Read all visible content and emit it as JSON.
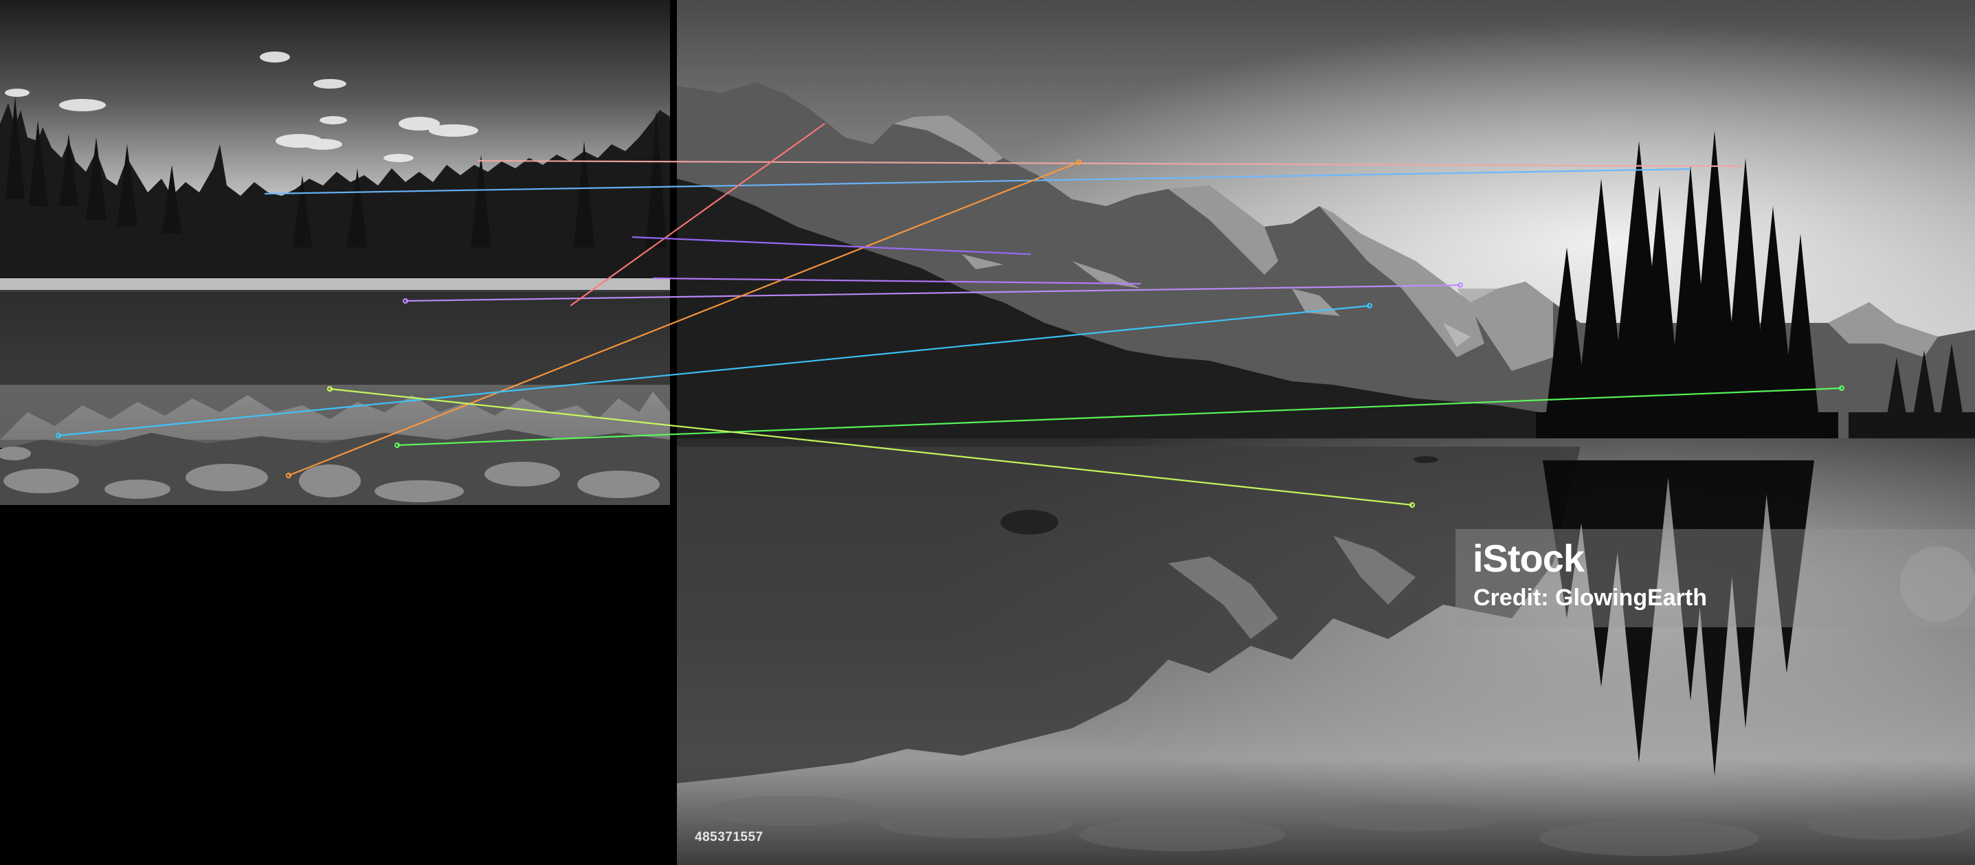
{
  "watermark": {
    "logo": "iStock",
    "credit": "Credit: GlowingEarth"
  },
  "image_id": "485371557",
  "match_colors": [
    "#f4a6a0",
    "#6ab7ff",
    "#c08cff",
    "#ff9a3c",
    "#b57bff",
    "#3cc8ff",
    "#5cff5c",
    "#c8ff5c",
    "#ff7a7a",
    "#ffd27a"
  ]
}
